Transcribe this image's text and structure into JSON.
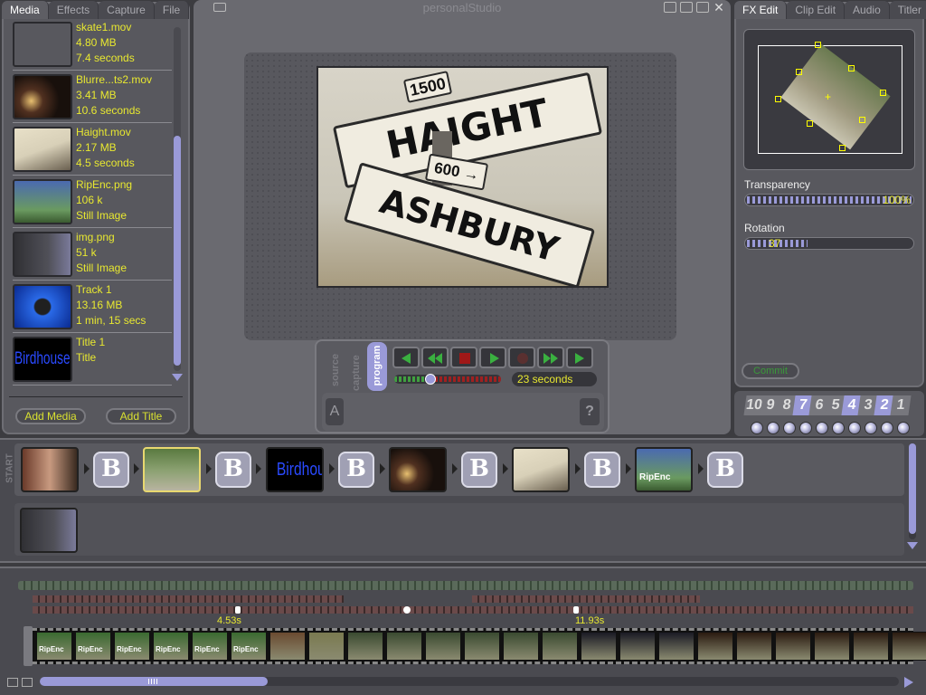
{
  "window": {
    "title": "personalStudio"
  },
  "left_tabs": [
    "Media",
    "Effects",
    "Capture",
    "File"
  ],
  "media_items": [
    {
      "name": "skate1.mov",
      "size": "4.80 MB",
      "duration": "7.4 seconds"
    },
    {
      "name": "Blurre...ts2.mov",
      "size": "3.41 MB",
      "duration": "10.6 seconds"
    },
    {
      "name": "Haight.mov",
      "size": "2.17 MB",
      "duration": "4.5 seconds"
    },
    {
      "name": "RipEnc.png",
      "size": "106 k",
      "duration": "Still Image"
    },
    {
      "name": "img.png",
      "size": "51 k",
      "duration": "Still Image"
    },
    {
      "name": "Track 1",
      "size": "13.16 MB",
      "duration": "1 min, 15 secs"
    },
    {
      "name": "Title 1",
      "size": "",
      "duration": "Title"
    }
  ],
  "buttons": {
    "add_media": "Add Media",
    "add_title": "Add Title",
    "commit": "Commit"
  },
  "preview": {
    "sign_top": "HAIGHT",
    "sign_bottom": "ASHBURY",
    "sign_num": "600 →",
    "sign_small": "1500"
  },
  "transport": {
    "modes": [
      "source",
      "capture",
      "program"
    ],
    "time": "23 seconds"
  },
  "right_tabs": [
    "FX Edit",
    "Clip Edit",
    "Audio",
    "Titler"
  ],
  "fx": {
    "transparency_label": "Transparency",
    "transparency_value": "100%",
    "transparency_level": 1.0,
    "rotation_label": "Rotation",
    "rotation_value": "37",
    "rotation_level": 0.37
  },
  "numbers": [
    "10",
    "9",
    "8",
    "7",
    "6",
    "5",
    "4",
    "3",
    "2",
    "1"
  ],
  "storyboard": {
    "start_label": "START",
    "title_clip": "Birdhouse",
    "ripenc": "RipEnc",
    "transition": "B"
  },
  "timeline": {
    "marker1": "4.53s",
    "marker2": "11.93s",
    "ripenc": "RipEnc"
  },
  "colors": {
    "panel": "#58585e",
    "accent": "#e8e830",
    "purple": "#9a9ad8"
  }
}
